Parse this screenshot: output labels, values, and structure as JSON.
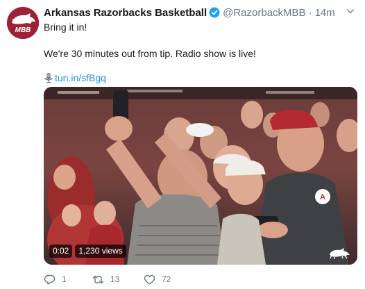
{
  "author": {
    "name": "Arkansas Razorbacks Basketball",
    "handle": "@RazorbackMBB",
    "separator": "·",
    "time": "14m",
    "avatar_text": "MBB",
    "verified": true
  },
  "tweet": {
    "line1": "Bring it in!",
    "line2": "We're 30 minutes out from tip. Radio show is live!",
    "link": "tun.in/sfBgq"
  },
  "video": {
    "duration": "0:02",
    "views": "1,230 views"
  },
  "actions": {
    "replies": "1",
    "retweets": "13",
    "likes": "72"
  },
  "colors": {
    "brand": "#9d2235",
    "link": "#1b95e0",
    "verified": "#1da1f2",
    "meta": "#657786"
  },
  "icons": [
    "razorback-logo-icon",
    "verified-badge-icon",
    "chevron-down-icon",
    "microphone-icon",
    "razorback-watermark-icon",
    "reply-icon",
    "retweet-icon",
    "like-icon"
  ]
}
